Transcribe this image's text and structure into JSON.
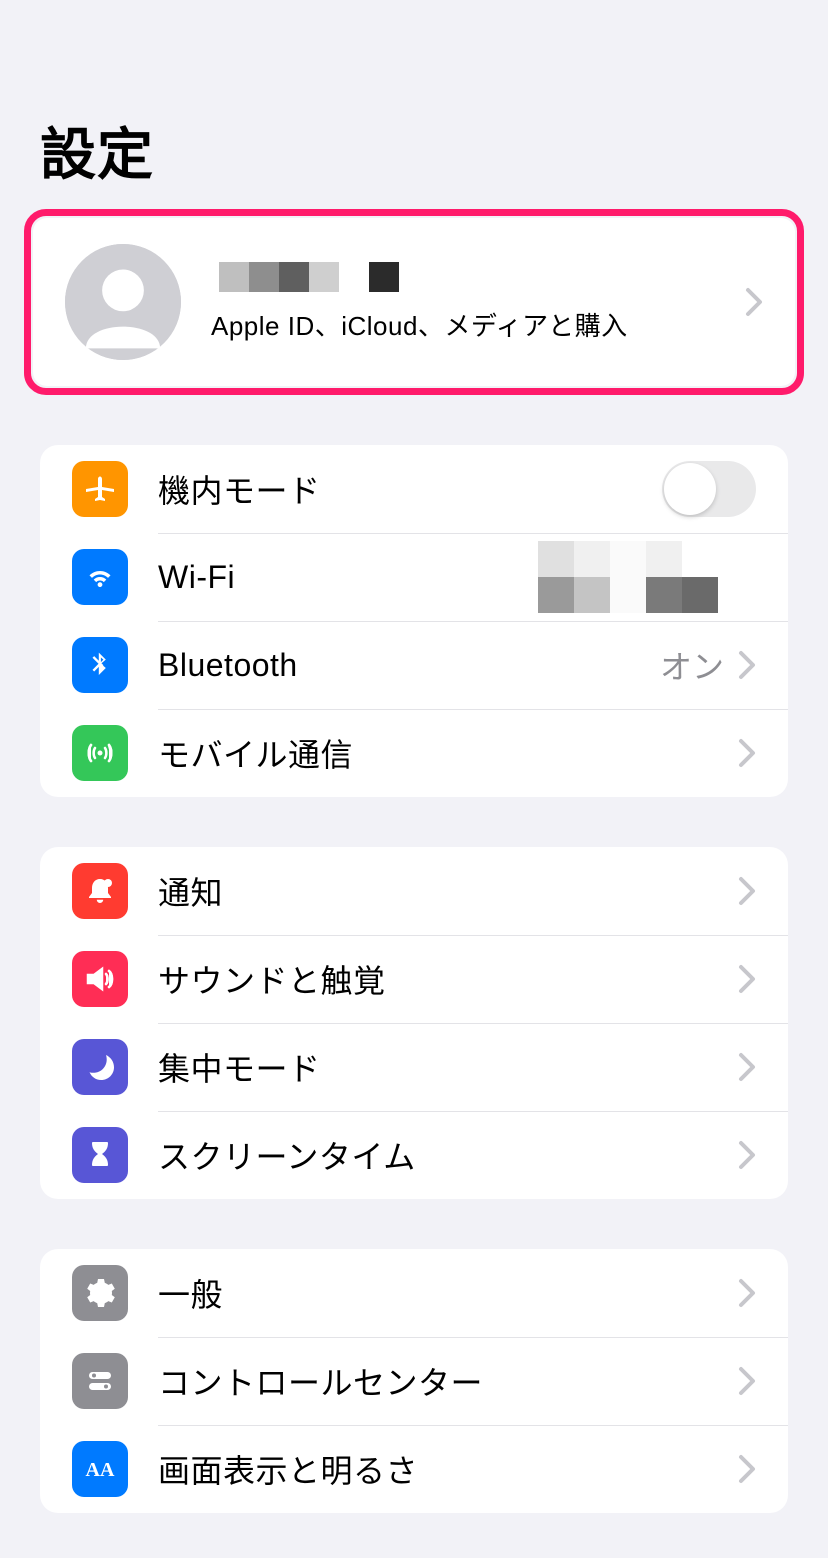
{
  "page": {
    "title": "設定"
  },
  "profile": {
    "subtitle": "Apple ID、iCloud、メディアと購入"
  },
  "group1": {
    "airplane": {
      "label": "機内モード",
      "toggle": false
    },
    "wifi": {
      "label": "Wi-Fi"
    },
    "bluetooth": {
      "label": "Bluetooth",
      "value": "オン"
    },
    "cellular": {
      "label": "モバイル通信"
    }
  },
  "group2": {
    "notifications": {
      "label": "通知"
    },
    "sounds": {
      "label": "サウンドと触覚"
    },
    "focus": {
      "label": "集中モード"
    },
    "screentime": {
      "label": "スクリーンタイム"
    }
  },
  "group3": {
    "general": {
      "label": "一般"
    },
    "controlcenter": {
      "label": "コントロールセンター"
    },
    "display": {
      "label": "画面表示と明るさ"
    }
  }
}
